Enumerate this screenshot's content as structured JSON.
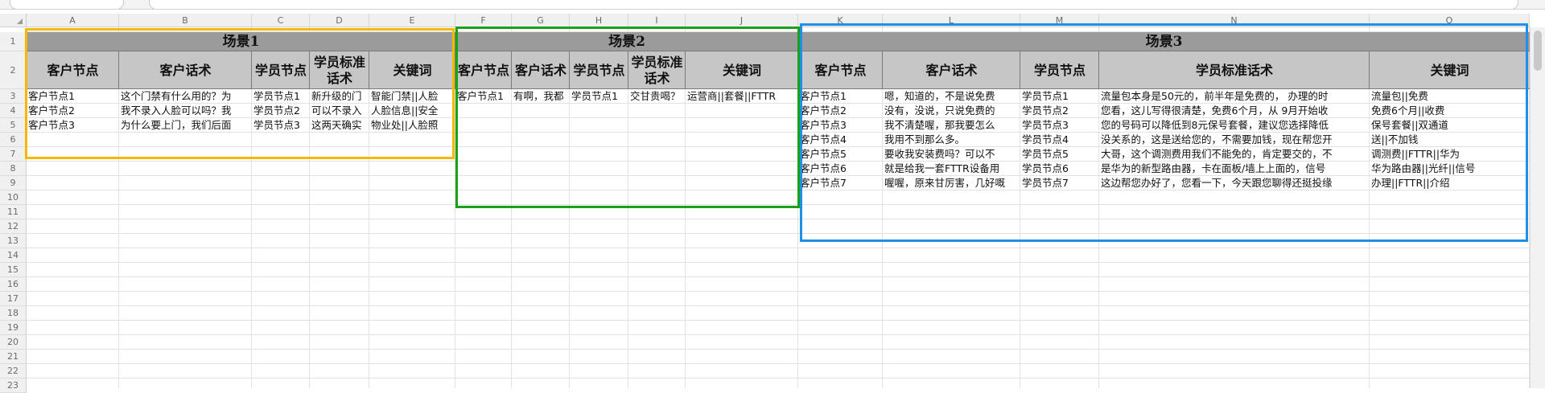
{
  "columns": [
    "A",
    "B",
    "C",
    "D",
    "E",
    "F",
    "G",
    "H",
    "I",
    "J",
    "K",
    "L",
    "M",
    "N",
    "O"
  ],
  "rows": [
    "1",
    "2",
    "3",
    "4",
    "5",
    "6",
    "7",
    "8",
    "9",
    "10",
    "11",
    "12",
    "13",
    "14",
    "15",
    "16",
    "17",
    "18",
    "19",
    "20",
    "21",
    "22",
    "23"
  ],
  "scenes": [
    "场景1",
    "场景2",
    "场景3"
  ],
  "headers": [
    "客户节点",
    "客户话术",
    "学员节点",
    "学员标准话术",
    "关键词",
    "客户节点",
    "客户话术",
    "学员节点",
    "学员标准话术",
    "关键词",
    "客户节点",
    "客户话术",
    "学员节点",
    "学员标准话术",
    "关键词"
  ],
  "data_rows": [
    [
      "客户节点1",
      "这个门禁有什么用的？为",
      "学员节点1",
      "新升级的门",
      "智能门禁||人脸",
      "客户节点1",
      "有啊，我都",
      "学员节点1",
      "交甘贵喝？",
      "运营商||套餐||FTTR",
      "客户节点1",
      "嗯，知道的，不是说免费",
      "学员节点1",
      "流量包本身是50元的，前半年是免费的， 办理的时",
      "流量包||免费"
    ],
    [
      "客户节点2",
      "我不录入人脸可以吗？我",
      "学员节点2",
      "可以不录入",
      "人脸信息||安全",
      "",
      "",
      "",
      "",
      "",
      "客户节点2",
      "没有，没说，只说免费的",
      "学员节点2",
      "您看，这儿写得很清楚，免费6个月，从  9月开始收",
      "免费6个月||收费"
    ],
    [
      "客户节点3",
      "为什么要上门，我们后面",
      "学员节点3",
      "这两天确实",
      "物业处||人脸照",
      "",
      "",
      "",
      "",
      "",
      "客户节点3",
      "我不清楚喔，那我要怎么",
      "学员节点3",
      "您的号码可以降低到8元保号套餐，建议您选择降低",
      "保号套餐||双通道"
    ],
    [
      "",
      "",
      "",
      "",
      "",
      "",
      "",
      "",
      "",
      "",
      "客户节点4",
      "我用不到那么多。",
      "学员节点4",
      "没关系的，这是送给您的，不需要加钱，现在帮您开",
      "送||不加钱"
    ],
    [
      "",
      "",
      "",
      "",
      "",
      "",
      "",
      "",
      "",
      "",
      "客户节点5",
      "要收我安装费吗？可以不",
      "学员节点5",
      "大哥，这个调测费用我们不能免的，肯定要交的，不",
      "调测费||FTTR||华为"
    ],
    [
      "",
      "",
      "",
      "",
      "",
      "",
      "",
      "",
      "",
      "",
      "客户节点6",
      "就是给我一套FTTR设备用",
      "学员节点6",
      "是华为的新型路由器，卡在面板/墙上上面的，信号",
      "华为路由器||光纤||信号"
    ],
    [
      "",
      "",
      "",
      "",
      "",
      "",
      "",
      "",
      "",
      "",
      "客户节点7",
      "喔喔，原来甘厉害，几好嘅",
      "学员节点7",
      "这边帮您办好了，您看一下，今天跟您聊得还挺投缘",
      "办理||FTTR||介绍"
    ]
  ],
  "colors": {
    "scene1_box": "#f5b800",
    "scene2_box": "#1aa11a",
    "scene3_box": "#1e90e6",
    "scene_band": "#9b9b9b",
    "header_band": "#c6c6c6"
  }
}
